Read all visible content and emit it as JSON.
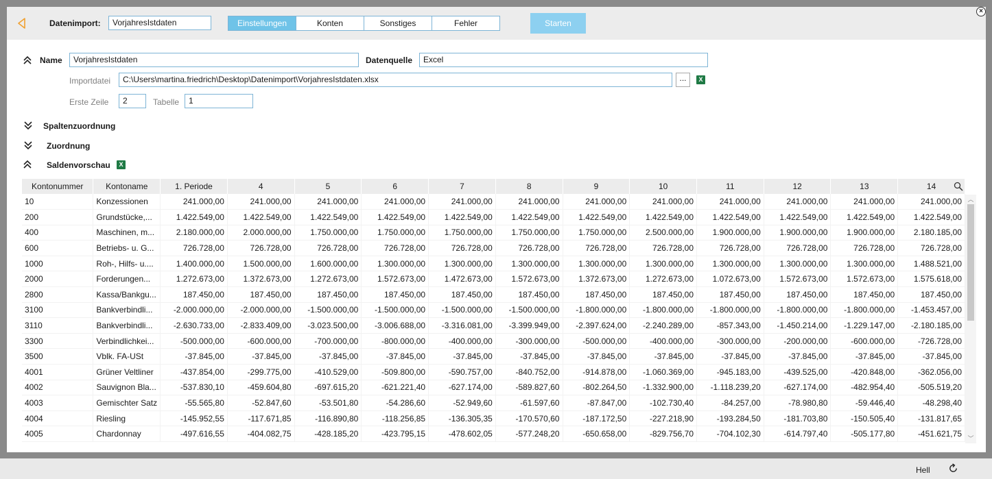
{
  "header": {
    "import_label": "Datenimport:",
    "import_value": "VorjahresIstdaten",
    "tabs": [
      {
        "label": "Einstellungen",
        "active": true
      },
      {
        "label": "Konten",
        "active": false
      },
      {
        "label": "Sonstiges",
        "active": false
      },
      {
        "label": "Fehler",
        "active": false
      }
    ],
    "start_label": "Starten",
    "close_glyph": "×"
  },
  "form": {
    "name_label": "Name",
    "name_value": "VorjahresIstdaten",
    "source_label": "Datenquelle",
    "source_value": "Excel",
    "importfile_label": "Importdatei",
    "importfile_value": "C:\\Users\\martina.friedrich\\Desktop\\Datenimport\\VorjahresIstdaten.xlsx",
    "browse_label": "...",
    "firstrow_label": "Erste Zeile",
    "firstrow_value": "2",
    "sheet_label": "Tabelle",
    "sheet_value": "1"
  },
  "sections": {
    "spalten": "Spaltenzuordnung",
    "zuordnung": "Zuordnung",
    "salden": "Saldenvorschau"
  },
  "grid": {
    "headers": [
      "Kontonummer",
      "Kontoname",
      "1. Periode",
      "4",
      "5",
      "6",
      "7",
      "8",
      "9",
      "10",
      "11",
      "12",
      "13",
      "14"
    ],
    "rows": [
      [
        "10",
        "Konzessionen",
        "241.000,00",
        "241.000,00",
        "241.000,00",
        "241.000,00",
        "241.000,00",
        "241.000,00",
        "241.000,00",
        "241.000,00",
        "241.000,00",
        "241.000,00",
        "241.000,00",
        "241.000,00"
      ],
      [
        "200",
        "Grundstücke,...",
        "1.422.549,00",
        "1.422.549,00",
        "1.422.549,00",
        "1.422.549,00",
        "1.422.549,00",
        "1.422.549,00",
        "1.422.549,00",
        "1.422.549,00",
        "1.422.549,00",
        "1.422.549,00",
        "1.422.549,00",
        "1.422.549,00"
      ],
      [
        "400",
        "Maschinen, m...",
        "2.180.000,00",
        "2.000.000,00",
        "1.750.000,00",
        "1.750.000,00",
        "1.750.000,00",
        "1.750.000,00",
        "1.750.000,00",
        "2.500.000,00",
        "1.900.000,00",
        "1.900.000,00",
        "1.900.000,00",
        "2.180.185,00"
      ],
      [
        "600",
        "Betriebs- u. G...",
        "726.728,00",
        "726.728,00",
        "726.728,00",
        "726.728,00",
        "726.728,00",
        "726.728,00",
        "726.728,00",
        "726.728,00",
        "726.728,00",
        "726.728,00",
        "726.728,00",
        "726.728,00"
      ],
      [
        "1000",
        "Roh-, Hilfs- u....",
        "1.400.000,00",
        "1.500.000,00",
        "1.600.000,00",
        "1.300.000,00",
        "1.300.000,00",
        "1.300.000,00",
        "1.300.000,00",
        "1.300.000,00",
        "1.300.000,00",
        "1.300.000,00",
        "1.300.000,00",
        "1.488.521,00"
      ],
      [
        "2000",
        "Forderungen...",
        "1.272.673,00",
        "1.372.673,00",
        "1.272.673,00",
        "1.572.673,00",
        "1.472.673,00",
        "1.572.673,00",
        "1.372.673,00",
        "1.272.673,00",
        "1.072.673,00",
        "1.572.673,00",
        "1.572.673,00",
        "1.575.618,00"
      ],
      [
        "2800",
        "Kassa/Bankgu...",
        "187.450,00",
        "187.450,00",
        "187.450,00",
        "187.450,00",
        "187.450,00",
        "187.450,00",
        "187.450,00",
        "187.450,00",
        "187.450,00",
        "187.450,00",
        "187.450,00",
        "187.450,00"
      ],
      [
        "3100",
        "Bankverbindli...",
        "-2.000.000,00",
        "-2.000.000,00",
        "-1.500.000,00",
        "-1.500.000,00",
        "-1.500.000,00",
        "-1.500.000,00",
        "-1.800.000,00",
        "-1.800.000,00",
        "-1.800.000,00",
        "-1.800.000,00",
        "-1.800.000,00",
        "-1.453.457,00"
      ],
      [
        "3110",
        "Bankverbindli...",
        "-2.630.733,00",
        "-2.833.409,00",
        "-3.023.500,00",
        "-3.006.688,00",
        "-3.316.081,00",
        "-3.399.949,00",
        "-2.397.624,00",
        "-2.240.289,00",
        "-857.343,00",
        "-1.450.214,00",
        "-1.229.147,00",
        "-2.180.185,00"
      ],
      [
        "3300",
        "Verbindlichkei...",
        "-500.000,00",
        "-600.000,00",
        "-700.000,00",
        "-800.000,00",
        "-400.000,00",
        "-300.000,00",
        "-500.000,00",
        "-400.000,00",
        "-300.000,00",
        "-200.000,00",
        "-600.000,00",
        "-726.728,00"
      ],
      [
        "3500",
        "Vblk. FA-USt",
        "-37.845,00",
        "-37.845,00",
        "-37.845,00",
        "-37.845,00",
        "-37.845,00",
        "-37.845,00",
        "-37.845,00",
        "-37.845,00",
        "-37.845,00",
        "-37.845,00",
        "-37.845,00",
        "-37.845,00"
      ],
      [
        "4001",
        "Grüner Veltliner",
        "-437.854,00",
        "-299.775,00",
        "-410.529,00",
        "-509.800,00",
        "-590.757,00",
        "-840.752,00",
        "-914.878,00",
        "-1.060.369,00",
        "-945.183,00",
        "-439.525,00",
        "-420.848,00",
        "-362.056,00"
      ],
      [
        "4002",
        "Sauvignon Bla...",
        "-537.830,10",
        "-459.604,80",
        "-697.615,20",
        "-621.221,40",
        "-627.174,00",
        "-589.827,60",
        "-802.264,50",
        "-1.332.900,00",
        "-1.118.239,20",
        "-627.174,00",
        "-482.954,40",
        "-505.519,20"
      ],
      [
        "4003",
        "Gemischter Satz",
        "-55.565,80",
        "-52.847,60",
        "-53.501,80",
        "-54.286,60",
        "-52.949,60",
        "-61.597,60",
        "-87.847,00",
        "-102.730,40",
        "-84.257,00",
        "-78.980,80",
        "-59.446,40",
        "-48.298,40"
      ],
      [
        "4004",
        "Riesling",
        "-145.952,55",
        "-117.671,85",
        "-116.890,80",
        "-118.256,85",
        "-136.305,35",
        "-170.570,60",
        "-187.172,50",
        "-227.218,90",
        "-193.284,50",
        "-181.703,80",
        "-150.505,40",
        "-131.817,65"
      ],
      [
        "4005",
        "Chardonnay",
        "-497.616,55",
        "-404.082,75",
        "-428.185,20",
        "-423.795,15",
        "-478.602,05",
        "-577.248,20",
        "-650.658,00",
        "-829.756,70",
        "-704.102,30",
        "-614.797,40",
        "-505.177,80",
        "-451.621,75"
      ]
    ]
  },
  "status": {
    "theme_label": "Hell"
  },
  "icons": {
    "excel": "X",
    "scroll_up": "︿",
    "scroll_down": "﹀"
  },
  "colors": {
    "accent": "#6fc3e8",
    "start_button": "#8dd0f0",
    "back_arrow": "#f0a030",
    "excel_green": "#1f7a45"
  }
}
